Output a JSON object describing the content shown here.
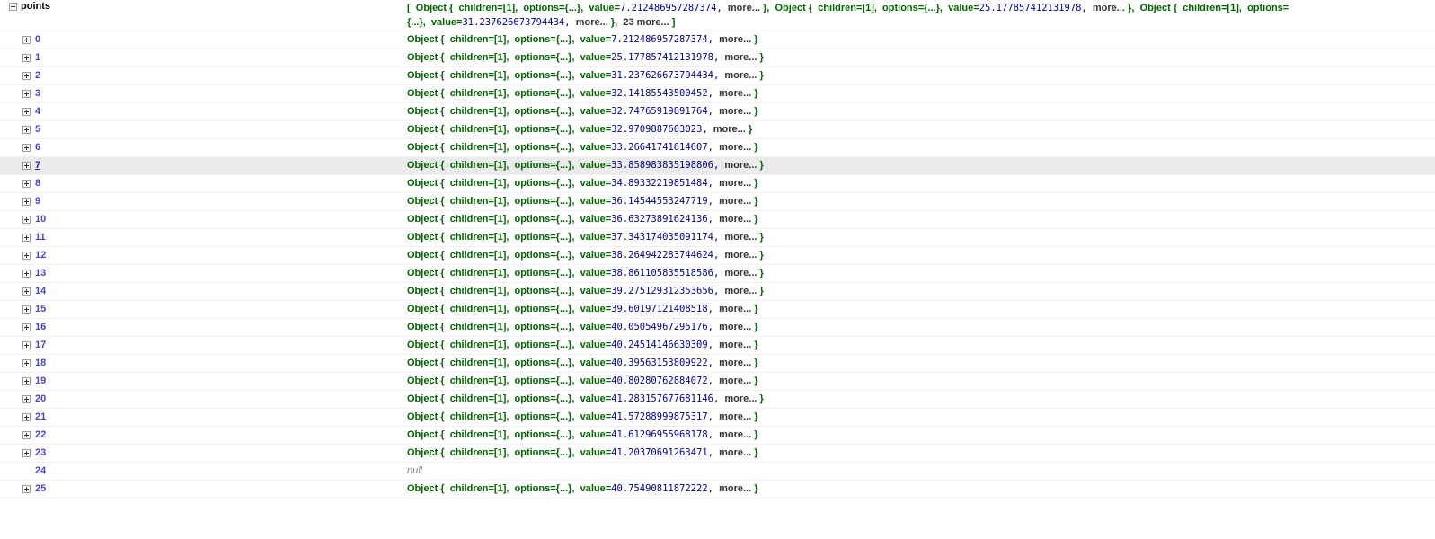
{
  "root": {
    "name": "points",
    "summary": {
      "open": "[",
      "items": [
        {
          "type": "Object",
          "children": "children=[1],",
          "options": "options={...},",
          "value_label": "value=",
          "value": "7.212486957287374,",
          "more": "more...",
          "close": "},"
        },
        {
          "type": "Object",
          "children": "children=[1],",
          "options": "options={...},",
          "value_label": "value=",
          "value": "25.177857412131978,",
          "more": "more...",
          "close": "},"
        },
        {
          "type": "Object",
          "children": "children=[1],",
          "options": "options={...},",
          "value_label": "value=",
          "value": "31.237626673794434,",
          "more": "more...",
          "close": "},"
        }
      ],
      "tail_more": "23 more...",
      "close": "]"
    }
  },
  "object_template": {
    "type": "Object",
    "open_brace": "{",
    "children": "children=[1],",
    "options": "options={...},",
    "value_label": "value=",
    "more": "more...",
    "close_brace": "}"
  },
  "items": [
    {
      "index": "0",
      "value": "7.212486957287374,"
    },
    {
      "index": "1",
      "value": "25.177857412131978,"
    },
    {
      "index": "2",
      "value": "31.237626673794434,"
    },
    {
      "index": "3",
      "value": "32.14185543500452,"
    },
    {
      "index": "4",
      "value": "32.74765919891764,"
    },
    {
      "index": "5",
      "value": "32.9709887603023,"
    },
    {
      "index": "6",
      "value": "33.26641741614607,"
    },
    {
      "index": "7",
      "value": "33.858983835198806,",
      "hover": true
    },
    {
      "index": "8",
      "value": "34.89332219851484,"
    },
    {
      "index": "9",
      "value": "36.14544553247719,"
    },
    {
      "index": "10",
      "value": "36.63273891624136,"
    },
    {
      "index": "11",
      "value": "37.343174035091174,"
    },
    {
      "index": "12",
      "value": "38.264942283744624,"
    },
    {
      "index": "13",
      "value": "38.861105835518586,"
    },
    {
      "index": "14",
      "value": "39.275129312353656,"
    },
    {
      "index": "15",
      "value": "39.60197121408518,"
    },
    {
      "index": "16",
      "value": "40.05054967295176,"
    },
    {
      "index": "17",
      "value": "40.24514146630309,"
    },
    {
      "index": "18",
      "value": "40.39563153809922,"
    },
    {
      "index": "19",
      "value": "40.80280762884072,"
    },
    {
      "index": "20",
      "value": "41.283157677681146,"
    },
    {
      "index": "21",
      "value": "41.57288999875317,"
    },
    {
      "index": "22",
      "value": "41.61296955968178,"
    },
    {
      "index": "23",
      "value": "41.20370691263471,"
    },
    {
      "index": "24",
      "null": true,
      "null_label": "null"
    },
    {
      "index": "25",
      "value": "40.75490811872222,"
    }
  ],
  "colors": {
    "property_name": "#4848c4",
    "object_keyword": "#006400",
    "number": "#000088",
    "hover_row": "#ebebeb",
    "null_text": "#888888"
  },
  "icons": {
    "collapse": "minus-box-icon",
    "expand": "plus-box-icon"
  }
}
